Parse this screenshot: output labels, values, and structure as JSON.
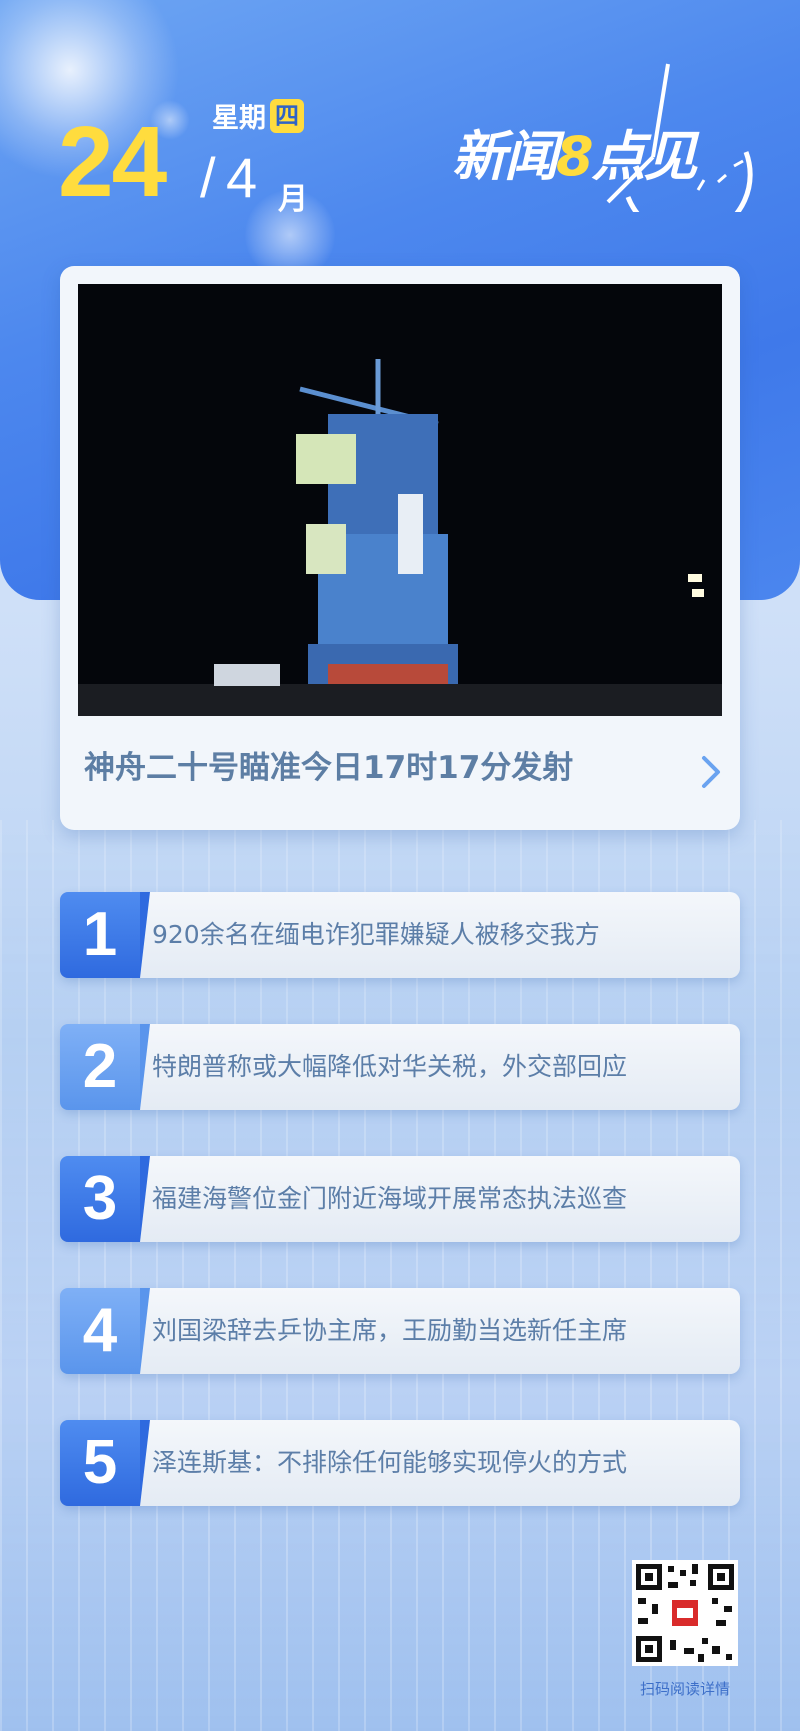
{
  "date": {
    "day": "24",
    "slash": "/",
    "month": "4",
    "month_unit": "月",
    "weekday_prefix": "星期",
    "weekday": "四"
  },
  "logo": {
    "text_before": "新闻",
    "number": "8",
    "text_after": "点见"
  },
  "headline": {
    "title": "神舟二十号瞄准今日17时17分发射",
    "chevron": "chevron-right-icon"
  },
  "news": [
    {
      "number": "1",
      "text": "920余名在缅电诈犯罪嫌疑人被移交我方"
    },
    {
      "number": "2",
      "text": "特朗普称或大幅降低对华关税，外交部回应"
    },
    {
      "number": "3",
      "text": "福建海警位金门附近海域开展常态执法巡查"
    },
    {
      "number": "4",
      "text": "刘国梁辞去乒协主席，王励勤当选新任主席"
    },
    {
      "number": "5",
      "text": "泽连斯基：不排除任何能够实现停火的方式"
    }
  ],
  "qr": {
    "label": "扫码阅读详情",
    "icon": "qr-code-icon"
  },
  "colors": {
    "accent_yellow": "#ffdc3e",
    "brand_blue": "#3f79ea",
    "text_blue": "#5c7ea8"
  }
}
